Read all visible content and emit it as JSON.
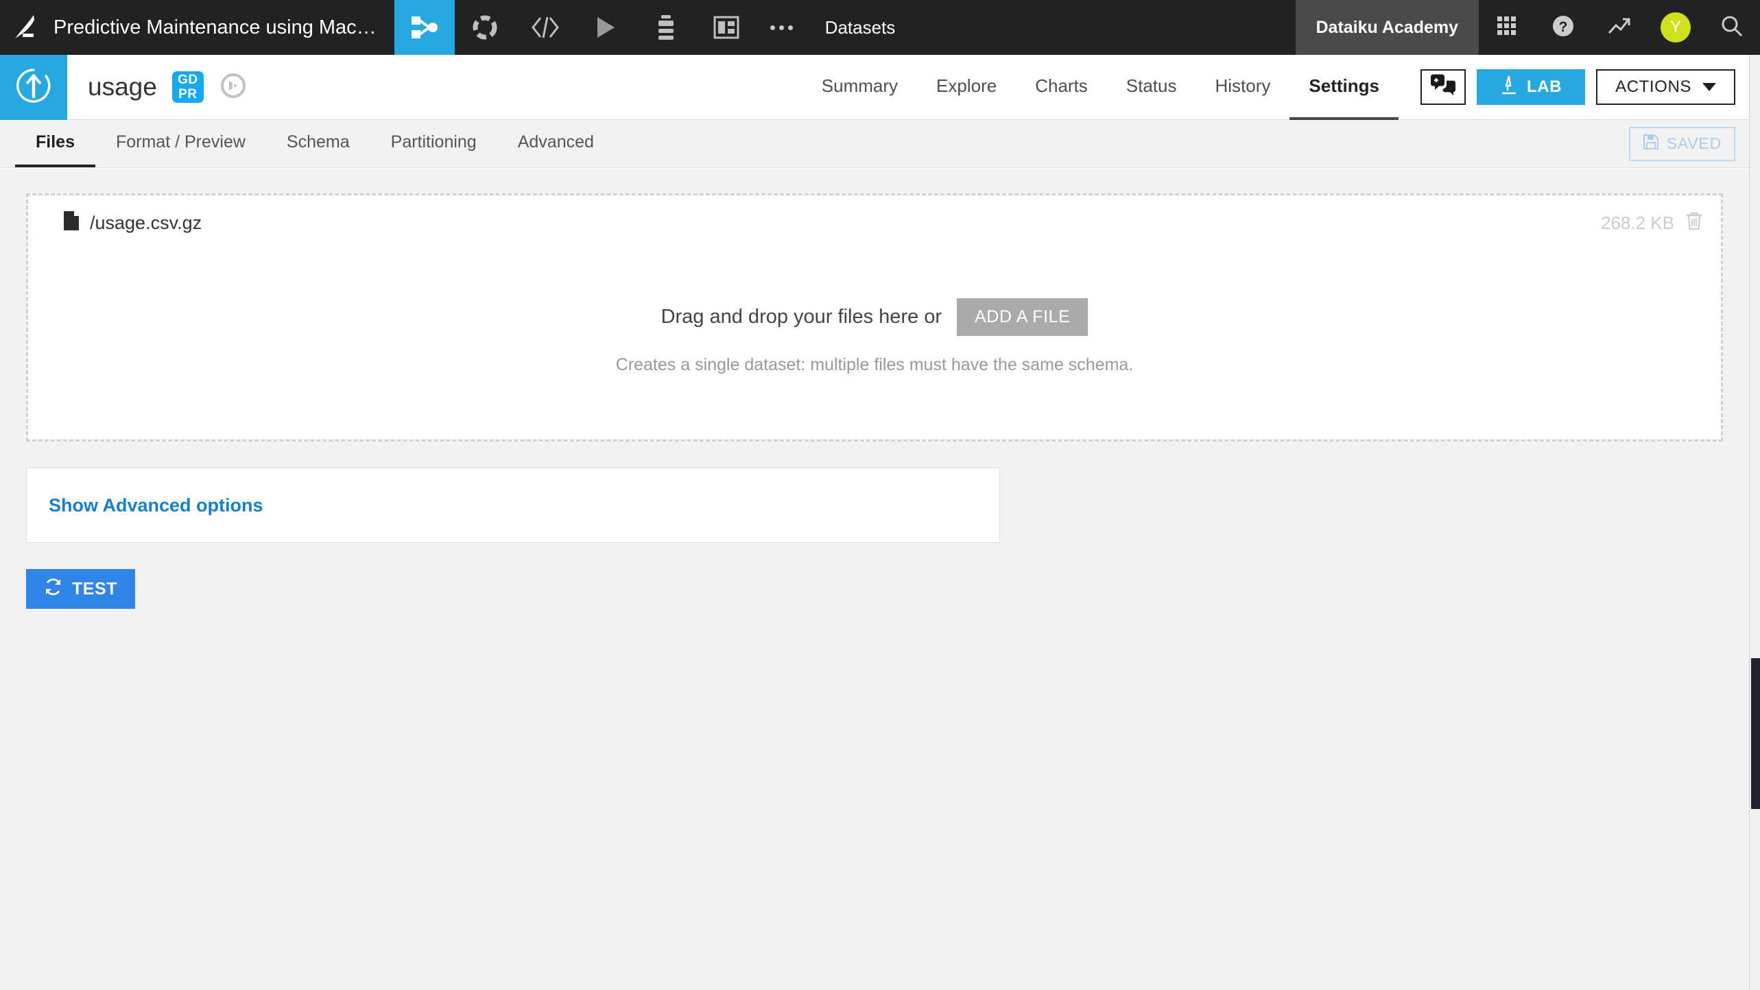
{
  "topnav": {
    "logo_icon": "dataiku-bird-logo",
    "project_title": "Predictive Maintenance using Mac…",
    "tiles": [
      {
        "icon": "flow-icon",
        "name": "nav-flow",
        "active": true
      },
      {
        "icon": "lab-dashed-circle-icon",
        "name": "nav-lab",
        "active": false
      },
      {
        "icon": "code-icon",
        "name": "nav-code",
        "active": false
      },
      {
        "icon": "play-icon",
        "name": "nav-jobs",
        "active": false
      },
      {
        "icon": "recipes-stack-icon",
        "name": "nav-automation",
        "active": false
      },
      {
        "icon": "dashboard-icon",
        "name": "nav-dashboards",
        "active": false
      }
    ],
    "more_icon": "more-dots-icon",
    "datasets_link": "Datasets",
    "academy_label": "Dataiku Academy",
    "right_icons": [
      {
        "icon": "apps-grid-icon",
        "name": "apps-grid-button"
      },
      {
        "icon": "help-question-icon",
        "name": "help-button"
      },
      {
        "icon": "trend-arrow-icon",
        "name": "monitoring-button"
      }
    ],
    "avatar_initial": "Y",
    "avatar_color": "#CFE01E",
    "search_icon": "search-icon",
    "accent_blue": "#28A8E0",
    "bar_color": "#222222"
  },
  "dataset_header": {
    "type_icon": "upload-circle-arrow-icon",
    "name": "usage",
    "gdpr_badge": {
      "line1": "GD",
      "line2": "PR",
      "color": "#18A8EF"
    },
    "compass_icon": "compass-circle-icon",
    "tabs": [
      {
        "label": "Summary",
        "active": false
      },
      {
        "label": "Explore",
        "active": false
      },
      {
        "label": "Charts",
        "active": false
      },
      {
        "label": "Status",
        "active": false
      },
      {
        "label": "History",
        "active": false
      },
      {
        "label": "Settings",
        "active": true
      }
    ],
    "discussions_icon": "discussion-add-icon",
    "lab_button": {
      "label": "LAB",
      "icon": "microscope-icon",
      "color": "#28A8E0"
    },
    "actions_button": {
      "label": "ACTIONS",
      "icon": "chevron-down-icon"
    }
  },
  "subtabs": {
    "items": [
      {
        "label": "Files",
        "active": true
      },
      {
        "label": "Format / Preview",
        "active": false
      },
      {
        "label": "Schema",
        "active": false
      },
      {
        "label": "Partitioning",
        "active": false
      },
      {
        "label": "Advanced",
        "active": false
      }
    ],
    "saved_badge": {
      "label": "SAVED",
      "icon": "floppy-save-icon"
    }
  },
  "main": {
    "dropzone": {
      "files": [
        {
          "icon": "file-icon",
          "path": "/usage.csv.gz",
          "size": "268.2 KB",
          "delete_icon": "trash-icon"
        }
      ],
      "prompt": "Drag and drop your files here or",
      "add_file_button": "ADD A FILE",
      "hint": "Creates a single dataset: multiple files must have the same schema."
    },
    "advanced_card": {
      "link": "Show Advanced options"
    },
    "test_button": {
      "label": "TEST",
      "icon": "refresh-icon",
      "color": "#2F86E8"
    }
  }
}
